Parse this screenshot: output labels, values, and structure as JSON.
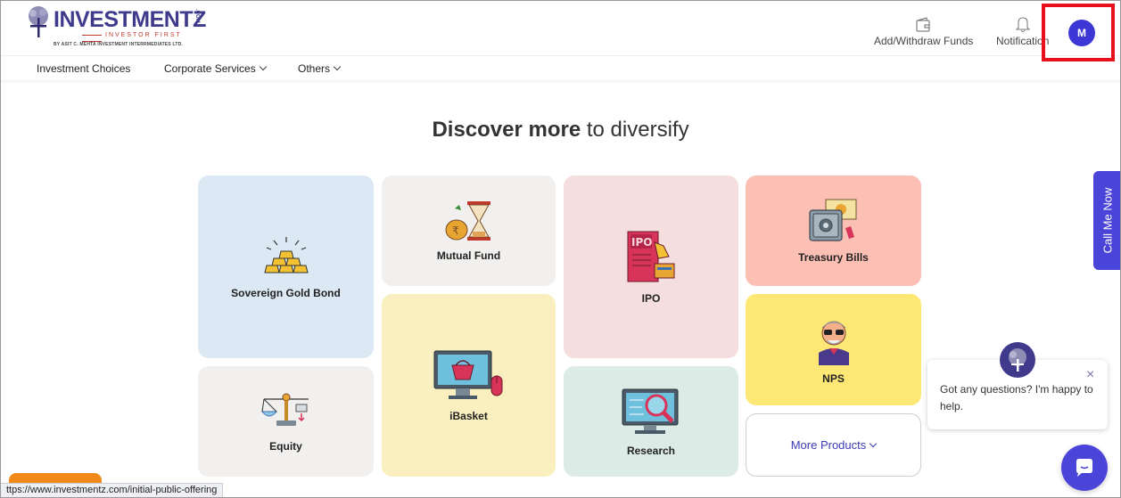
{
  "header": {
    "logo_word": "INVESTMENTZ",
    "logo_com": ".COM",
    "logo_tagline": "INVESTOR FIRST",
    "logo_sub": "BY ASIT C. MEHTA INVESTMENT INTERRMEDIATES LTD.",
    "add_withdraw_label": "Add/Withdraw Funds",
    "notification_label": "Notification",
    "avatar_initial": "M",
    "highlight_color": "#e8101a"
  },
  "nav": {
    "items": [
      {
        "label": "Investment Choices"
      },
      {
        "label": "Corporate Services"
      },
      {
        "label": "Others"
      }
    ]
  },
  "main": {
    "title_bold": "Discover more",
    "title_rest": "to diversify",
    "cards": [
      {
        "label": "Sovereign Gold Bond",
        "color": "#dce8f4",
        "icon": "gold-bars-icon"
      },
      {
        "label": "Mutual Fund",
        "color": "#f1f0ee",
        "icon": "money-hourglass-icon"
      },
      {
        "label": "IPO",
        "color": "#f4dede",
        "icon": "ipo-document-icon"
      },
      {
        "label": "Treasury Bills",
        "color": "#fbc0b3",
        "icon": "safe-vault-icon"
      },
      {
        "label": "iBasket",
        "color": "#faefbf",
        "icon": "monitor-basket-icon"
      },
      {
        "label": "NPS",
        "color": "#fde875",
        "icon": "elderly-man-icon"
      },
      {
        "label": "Equity",
        "color": "#f1f0ee",
        "icon": "balance-scale-icon"
      },
      {
        "label": "Research",
        "color": "#dcebe6",
        "icon": "magnifier-monitor-icon"
      }
    ],
    "more_products_label": "More Products"
  },
  "call_me_now": "Call Me Now",
  "chat": {
    "message": "Got any questions? I'm happy to help.",
    "close_symbol": "×"
  },
  "status_url": "ttps://www.investmentz.com/initial-public-offering"
}
